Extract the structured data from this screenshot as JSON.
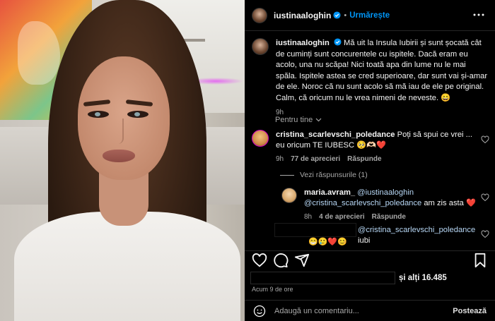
{
  "header": {
    "username": "iustinaaloghin",
    "separator": "•",
    "follow_label": "Urmărește"
  },
  "caption": {
    "username": "iustinaaloghin",
    "text": "Mă uit la Insula Iubirii și sunt șocată cât de cuminți sunt concurentele cu ispitele. Dacă eram eu acolo, una nu scăpa! Nici toată apa din lume nu le mai spăla. Ispitele astea se cred superioare, dar sunt vai și-amar de ele. Noroc că nu sunt acolo să mă iau de ele pe original. Calm, că oricum nu le vrea nimeni de neveste. 😄",
    "time": "9h"
  },
  "filter": {
    "label": "Pentru tine"
  },
  "comments": [
    {
      "username": "cristina_scarlevschi_poledance",
      "text": "Poți să spui ce vrei ... eu oricum TE IUBESC 🥺🫶🏻❤️",
      "time": "9h",
      "likes": "77 de aprecieri",
      "reply_label": "Răspunde"
    }
  ],
  "replies_toggle": "Vezi răspunsurile (1)",
  "replies": [
    {
      "username": "maria.avram_",
      "mention1": "@iustinaaloghin",
      "mention2": "@cristina_scarlevschi_poledance",
      "text": "am zis asta ❤️",
      "time": "8h",
      "likes": "4 de aprecieri",
      "reply_label": "Răspunde"
    },
    {
      "mention": "@cristina_scarlevschi_poledance",
      "text": "iubi",
      "emojis": "😁🥲❤️😊"
    }
  ],
  "likes": {
    "text": "și alți 16.485"
  },
  "timestamp": "Acum 9 de ore",
  "add_comment": {
    "placeholder": "Adaugă un comentariu...",
    "post_label": "Postează"
  },
  "colors": {
    "accent": "#0095f6",
    "background": "#000000",
    "muted": "#a8a8a8",
    "like_red": "#ff3040"
  }
}
